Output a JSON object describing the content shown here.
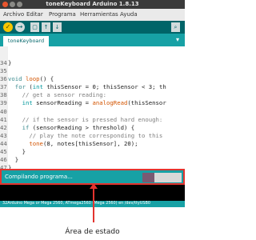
{
  "window": {
    "title": "toneKeyboard Arduino 1.8.13"
  },
  "menu": {
    "items": [
      "Archivo",
      "Editar",
      "Programa",
      "Herramientas",
      "Ayuda"
    ]
  },
  "toolbar": {
    "verify": "✓",
    "upload": "→",
    "new": "▢",
    "open": "↑",
    "save": "↓",
    "monitor": "⌕"
  },
  "tabs": [
    {
      "label": "toneKeyboard"
    }
  ],
  "editor": {
    "lines": [
      {
        "n": "34",
        "parts": [
          {
            "t": "}",
            "c": "plain"
          }
        ]
      },
      {
        "n": "35",
        "parts": [
          {
            "t": "",
            "c": "plain"
          }
        ]
      },
      {
        "n": "36",
        "parts": [
          {
            "t": "void",
            "c": "kw"
          },
          {
            "t": " ",
            "c": "plain"
          },
          {
            "t": "loop",
            "c": "fn"
          },
          {
            "t": "() {",
            "c": "plain"
          }
        ]
      },
      {
        "n": "37",
        "parts": [
          {
            "t": "  ",
            "c": "plain"
          },
          {
            "t": "for",
            "c": "kw"
          },
          {
            "t": " (",
            "c": "plain"
          },
          {
            "t": "int",
            "c": "ty"
          },
          {
            "t": " thisSensor = 0; thisSensor < 3; th",
            "c": "plain"
          }
        ]
      },
      {
        "n": "38",
        "parts": [
          {
            "t": "    // get a sensor reading:",
            "c": "cm"
          }
        ]
      },
      {
        "n": "39",
        "parts": [
          {
            "t": "    ",
            "c": "plain"
          },
          {
            "t": "int",
            "c": "ty"
          },
          {
            "t": " sensorReading = ",
            "c": "plain"
          },
          {
            "t": "analogRead",
            "c": "fn"
          },
          {
            "t": "(thisSensor",
            "c": "plain"
          }
        ]
      },
      {
        "n": "40",
        "parts": [
          {
            "t": "",
            "c": "plain"
          }
        ]
      },
      {
        "n": "41",
        "parts": [
          {
            "t": "    // if the sensor is pressed hard enough:",
            "c": "cm"
          }
        ]
      },
      {
        "n": "42",
        "parts": [
          {
            "t": "    ",
            "c": "plain"
          },
          {
            "t": "if",
            "c": "kw"
          },
          {
            "t": " (sensorReading > threshold) {",
            "c": "plain"
          }
        ]
      },
      {
        "n": "43",
        "parts": [
          {
            "t": "      // play the note corresponding to this",
            "c": "cm"
          }
        ]
      },
      {
        "n": "44",
        "parts": [
          {
            "t": "      ",
            "c": "plain"
          },
          {
            "t": "tone",
            "c": "fn"
          },
          {
            "t": "(8, notes[thisSensor], 20);",
            "c": "plain"
          }
        ]
      },
      {
        "n": "45",
        "parts": [
          {
            "t": "    }",
            "c": "plain"
          }
        ]
      },
      {
        "n": "46",
        "parts": [
          {
            "t": "  }",
            "c": "plain"
          }
        ]
      },
      {
        "n": "47",
        "parts": [
          {
            "t": "}",
            "c": "plain"
          }
        ]
      }
    ]
  },
  "status": {
    "text": "Compilando programa...",
    "progress_fraction": 0.31
  },
  "footer": {
    "text": "32Arduino Mega or Mega 2560, ATmega2560 (Mega 2560) en /dev/ttyUSB0"
  },
  "annotation": {
    "label": "Área de estado"
  },
  "colors": {
    "teal": "#17a1a5",
    "dark_teal": "#006468",
    "highlight_red": "#e3342f"
  }
}
